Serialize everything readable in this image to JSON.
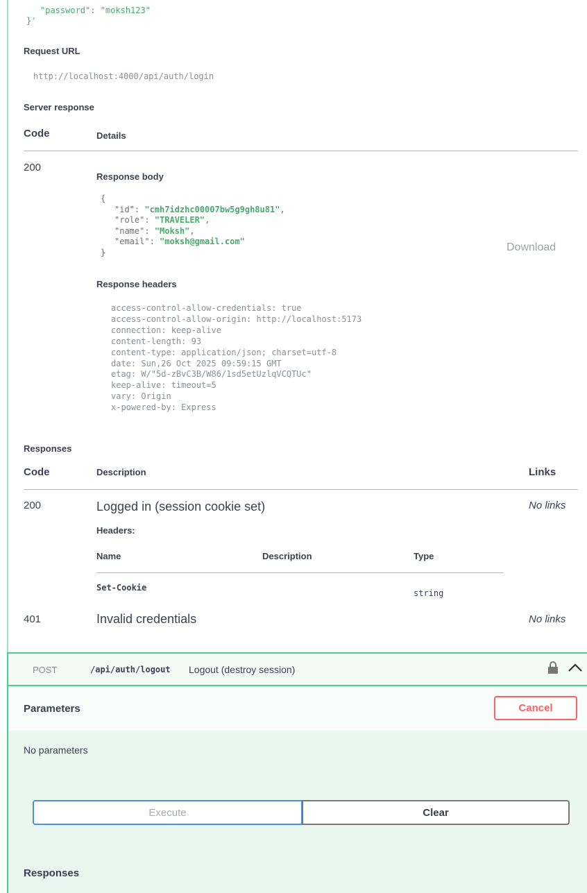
{
  "top": {
    "password_key": "\"password\"",
    "password_colon": ": ",
    "password_value": "\"moksh123\"",
    "closing": "}'"
  },
  "request_url": {
    "label": "Request URL",
    "value": "http://localhost:4000/api/auth/login"
  },
  "server_response": {
    "label": "Server response",
    "code_header": "Code",
    "details_header": "Details",
    "code": "200",
    "body_label": "Response body",
    "body": {
      "open": "{",
      "close": "}",
      "lines": [
        {
          "key": "\"id\"",
          "value": "\"cmh7idzhc00007bw5g9gh8u81\"",
          "trail": ","
        },
        {
          "key": "\"role\"",
          "value": "\"TRAVELER\"",
          "trail": ","
        },
        {
          "key": "\"name\"",
          "value": "\"Moksh\"",
          "trail": ","
        },
        {
          "key": "\"email\"",
          "value": "\"moksh@gmail.com\"",
          "trail": ""
        }
      ]
    },
    "download_label": "Download",
    "headers_label": "Response headers",
    "headers": [
      "access-control-allow-credentials: true",
      "access-control-allow-origin: http://localhost:5173",
      "connection: keep-alive",
      "content-length: 93",
      "content-type: application/json; charset=utf-8",
      "date: Sun,26 Oct 2025 09:59:15 GMT",
      "etag: W/\"5d-zBvC3B/W86/1sd5etUzlqVCQTUc\"",
      "keep-alive: timeout=5",
      "vary: Origin",
      "x-powered-by: Express"
    ]
  },
  "responses": {
    "label": "Responses",
    "code_header": "Code",
    "description_header": "Description",
    "links_header": "Links",
    "rows": [
      {
        "code": "200",
        "description": "Logged in (session cookie set)",
        "links": "No links"
      },
      {
        "code": "401",
        "description": "Invalid credentials",
        "links": "No links"
      }
    ],
    "headers_label": "Headers:",
    "header_table": {
      "name_header": "Name",
      "description_header": "Description",
      "type_header": "Type",
      "row_name": "Set-Cookie",
      "row_type": "string"
    }
  },
  "logout": {
    "method": "POST",
    "path": "/api/auth/logout",
    "summary": "Logout (destroy session)",
    "parameters_label": "Parameters",
    "cancel_label": "Cancel",
    "no_parameters": "No parameters",
    "execute_label": "Execute",
    "clear_label": "Clear",
    "responses_label": "Responses",
    "lock_icon": "lock-icon",
    "chevron_icon": "chevron-up-icon"
  },
  "colors": {
    "accent_green": "#49cc90",
    "cancel_red": "#ff6060",
    "execute_blue": "#4990e2"
  }
}
